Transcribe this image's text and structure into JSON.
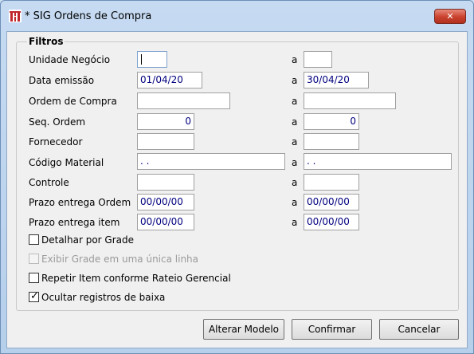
{
  "window": {
    "title": "* SIG Ordens de Compra",
    "close_glyph": "✕"
  },
  "group": {
    "legend": "Filtros"
  },
  "range_sep": "a",
  "rows": [
    {
      "label": "Unidade Negócio",
      "from": "",
      "to": ""
    },
    {
      "label": "Data emissão",
      "from": "01/04/20",
      "to": "30/04/20"
    },
    {
      "label": "Ordem de Compra",
      "from": "",
      "to": ""
    },
    {
      "label": "Seq. Ordem",
      "from": "0",
      "to": "0"
    },
    {
      "label": "Fornecedor",
      "from": "",
      "to": ""
    },
    {
      "label": "Código Material",
      "from": " .  .",
      "to": " .  ."
    },
    {
      "label": "Controle",
      "from": "",
      "to": ""
    },
    {
      "label": "Prazo entrega Ordem",
      "from": "00/00/00",
      "to": "00/00/00"
    },
    {
      "label": "Prazo entrega item",
      "from": "00/00/00",
      "to": "00/00/00"
    }
  ],
  "checkboxes": [
    {
      "label": "Detalhar por Grade",
      "checked": false,
      "enabled": true
    },
    {
      "label": "Exibir Grade em uma única linha",
      "checked": false,
      "enabled": false
    },
    {
      "label": "Repetir Item conforme Rateio Gerencial",
      "checked": false,
      "enabled": true
    },
    {
      "label": "Ocultar registros de baixa",
      "checked": true,
      "enabled": true
    }
  ],
  "check_glyph": "✓",
  "buttons": {
    "alterar_modelo": "Alterar Modelo",
    "confirmar": "Confirmar",
    "cancelar": "Cancelar"
  },
  "colors": {
    "field_text": "#00007f",
    "close_button": "#c9412d",
    "logo": "#c0272d"
  }
}
